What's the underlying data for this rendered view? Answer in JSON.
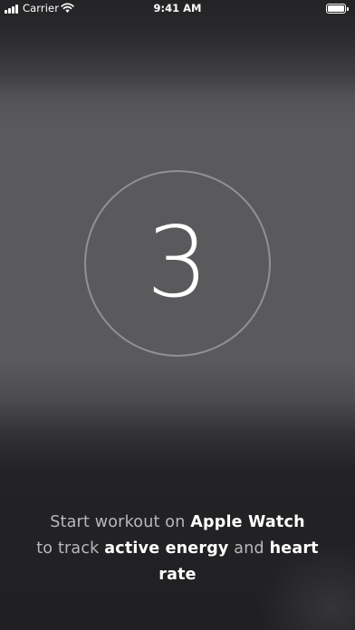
{
  "status_bar": {
    "carrier": "Carrier",
    "time": "9:41 AM",
    "battery_level": 1.0,
    "icons": [
      "signal-bars-icon",
      "wifi-icon",
      "battery-icon"
    ]
  },
  "countdown": {
    "value": "3"
  },
  "message": {
    "part1": "Start workout on ",
    "part2": "Apple Watch",
    "part3": "to track ",
    "part4": "active energy",
    "part5": " and ",
    "part6": "heart rate"
  },
  "colors": {
    "background": "#5a5a5c",
    "background_dark": "#202022",
    "text_primary": "#ffffff",
    "text_secondary": "#b9b9bb",
    "ring": "#bebec0"
  }
}
